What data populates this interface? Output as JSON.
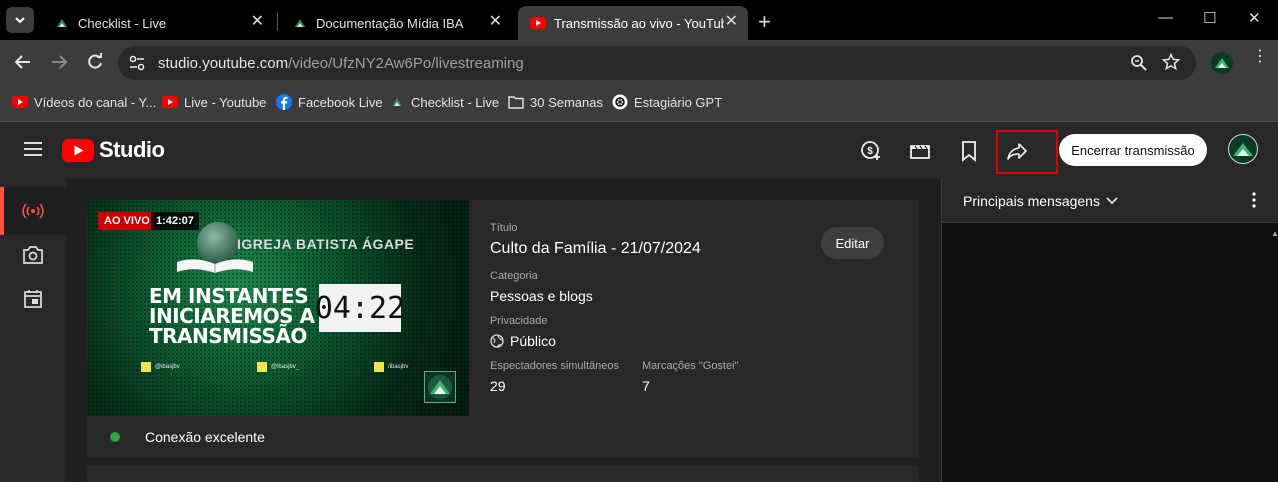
{
  "browser": {
    "tabs": [
      {
        "title": "Checklist - Live",
        "favicon": "leaf-icon"
      },
      {
        "title": "Documentação Mídia IBA",
        "favicon": "leaf-icon"
      },
      {
        "title": "Transmissão ao vivo - YouTube",
        "favicon": "youtube-icon",
        "active": true
      }
    ],
    "url_domain": "studio.youtube.com",
    "url_path": "/video/UfzNY2Aw6Po/livestreaming",
    "bookmarks": [
      {
        "label": "Vídeos do canal - Y...",
        "icon": "youtube-icon"
      },
      {
        "label": "Live - Youtube",
        "icon": "youtube-icon"
      },
      {
        "label": "Facebook Live",
        "icon": "facebook-icon"
      },
      {
        "label": "Checklist - Live",
        "icon": "leaf-icon"
      },
      {
        "label": "30 Semanas",
        "icon": "folder-icon"
      },
      {
        "label": "Estagiário GPT",
        "icon": "openai-icon"
      }
    ]
  },
  "studio": {
    "logo_text": "Studio",
    "end_button": "Encerrar transmissão",
    "colors": {
      "accent_red": "#ff0000",
      "live_red": "#cc0000",
      "highlight_box": "#e00000",
      "status_green": "#2ba640"
    }
  },
  "stream": {
    "live_badge": "AO VIVO",
    "duration": "1:42:07",
    "thumbnail": {
      "church_name": "IGREJA BATISTA ÁGAPE",
      "slogan_line1": "EM INSTANTES",
      "slogan_line2": "INICIAREMOS A",
      "slogan_line3": "TRANSMISSÃO",
      "countdown": "04:22",
      "social": [
        "@ibasjbv",
        "@ibasjbv_",
        "/ibasjbv"
      ]
    },
    "title_label": "Título",
    "title": "Culto da Família - 21/07/2024",
    "edit_button": "Editar",
    "category_label": "Categoria",
    "category": "Pessoas e blogs",
    "privacy_label": "Privacidade",
    "privacy": "Público",
    "viewers_label": "Espectadores simultâneos",
    "viewers": "29",
    "likes_label": "Marcações \"Gostei\"",
    "likes": "7",
    "connection": "Conexão excelente"
  },
  "chat": {
    "title": "Principais mensagens"
  }
}
